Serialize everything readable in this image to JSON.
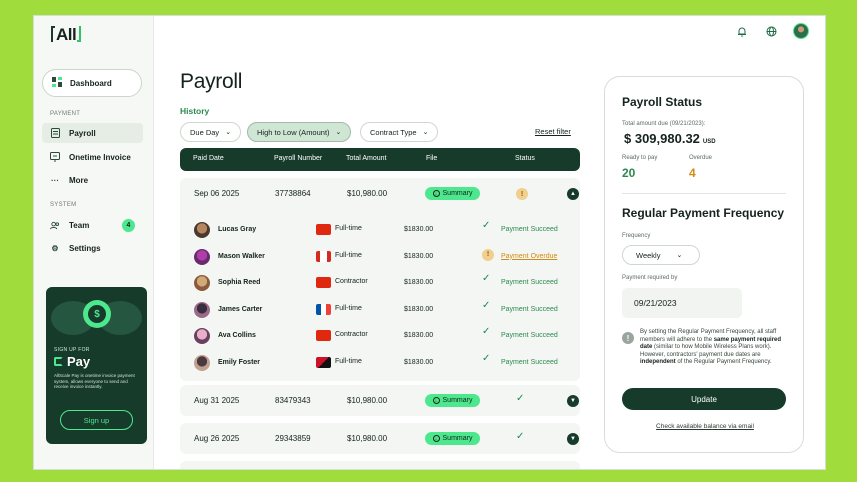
{
  "brand": {
    "logo_text": "All"
  },
  "sidebar": {
    "dashboard": "Dashboard",
    "section_payment": "PAYMENT",
    "payroll": "Payroll",
    "onetime_invoice": "Onetime Invoice",
    "more": "More",
    "section_system": "SYSTEM",
    "team": "Team",
    "team_count": "4",
    "settings": "Settings",
    "promo": {
      "signup_for": "SIGN UP FOR",
      "product": "Pay",
      "coin_symbol": "$",
      "description": "AllScale Pay is onetime invoice payment system, allows everyone to send and receive invoice instantly.",
      "button": "Sign up"
    }
  },
  "main": {
    "title": "Payroll",
    "history_label": "History",
    "filters": {
      "day": "Due Day",
      "sort": "High to Low (Amount)",
      "contract": "Contract Type",
      "reset": "Reset filter"
    },
    "columns": [
      "Paid Date",
      "Payroll Number",
      "Total Amount",
      "File",
      "Status"
    ],
    "summary_label": "Summary",
    "groups": [
      {
        "date": "Sep 06 2025",
        "number": "37738864",
        "amount": "$10,980.00",
        "status": "warning",
        "expanded": true
      },
      {
        "date": "Aug 31 2025",
        "number": "83479343",
        "amount": "$10,980.00",
        "status": "success",
        "expanded": false
      },
      {
        "date": "Aug 26 2025",
        "number": "29343859",
        "amount": "$10,980.00",
        "status": "success",
        "expanded": false
      }
    ],
    "employees": [
      {
        "name": "Lucas Gray",
        "type": "Full-time",
        "amount": "$1830.00",
        "status": "Payment Succeed",
        "overdue": false,
        "flag": "hk"
      },
      {
        "name": "Mason Walker",
        "type": "Full-time",
        "amount": "$1830.00",
        "status": "Payment Overdue",
        "overdue": true,
        "flag": "ca"
      },
      {
        "name": "Sophia Reed",
        "type": "Contractor",
        "amount": "$1830.00",
        "status": "Payment Succeed",
        "overdue": false,
        "flag": "hk"
      },
      {
        "name": "James Carter",
        "type": "Full-time",
        "amount": "$1830.00",
        "status": "Payment Succeed",
        "overdue": false,
        "flag": "fr"
      },
      {
        "name": "Ava Collins",
        "type": "Contractor",
        "amount": "$1830.00",
        "status": "Payment Succeed",
        "overdue": false,
        "flag": "hk"
      },
      {
        "name": "Emily Foster",
        "type": "Full-time",
        "amount": "$1830.00",
        "status": "Payment Succeed",
        "overdue": false,
        "flag": "pg"
      }
    ]
  },
  "status_panel": {
    "title": "Payroll Status",
    "due_label": "Total amount due (09/21/2023):",
    "due_amount": "$ 309,980.32",
    "currency": "USD",
    "ready_label": "Ready to pay",
    "ready_value": "20",
    "overdue_label": "Overdue",
    "overdue_value": "4",
    "freq_title": "Regular Payment Frequency",
    "frequency_label": "Frequency",
    "frequency_value": "Weekly",
    "required_label": "Payment required by",
    "required_date": "09/21/2023",
    "note_1": "By setting the Regular Payment Frequency, all staff members will adhere to the ",
    "note_b1": "same payment required date",
    "note_2": " (similar to how Mobile Wireless Plans work). However, contractors' payment due dates are ",
    "note_b2": "independent",
    "note_3": " of the Regular Payment Frequency.",
    "update_button": "Update",
    "check_link": "Check available balance via email"
  },
  "colors": {
    "accent": "#4de88d",
    "dark": "#173b2b",
    "success": "#2c8a4f",
    "overdue": "#d18a14",
    "background": "#9fdc3c"
  }
}
